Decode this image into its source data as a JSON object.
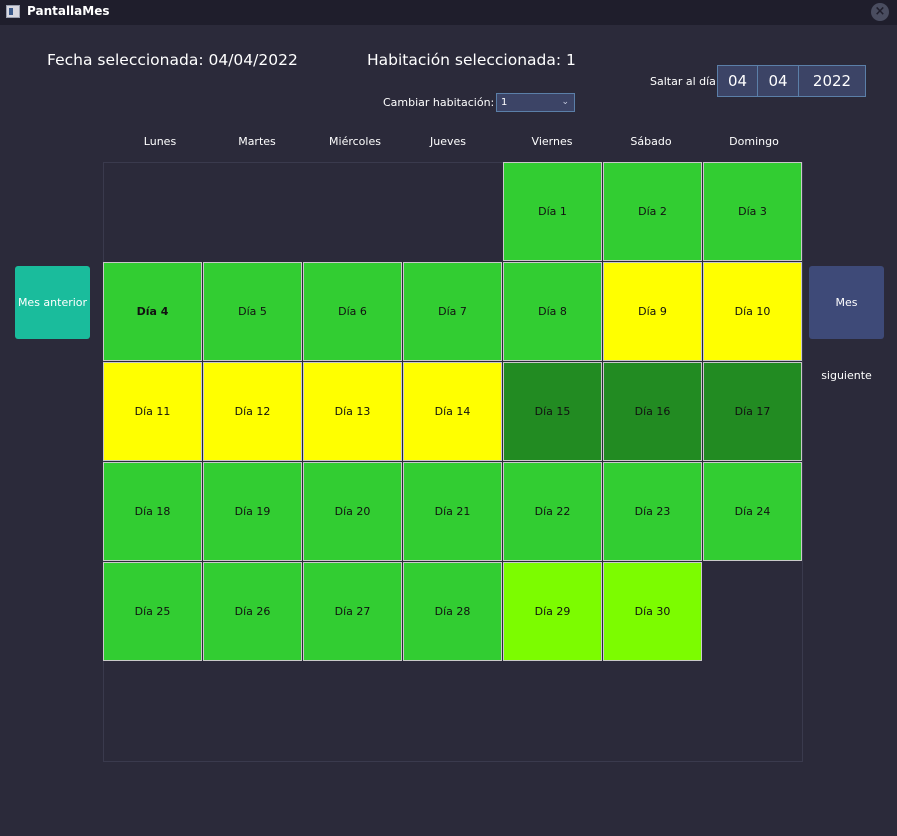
{
  "window": {
    "title": "PantallaMes"
  },
  "header": {
    "selected_date": "Fecha seleccionada: 04/04/2022",
    "selected_room": "Habitación seleccionada: 1",
    "jump_label": "Saltar al día:",
    "jump_day": "04",
    "jump_month": "04",
    "jump_year": "2022",
    "change_room_label": "Cambiar habitación:",
    "room_value": "1"
  },
  "weekdays": [
    "Lunes",
    "Martes",
    "Miércoles",
    "Jueves",
    "Viernes",
    "Sábado",
    "Domingo"
  ],
  "nav": {
    "prev": "Mes anterior",
    "next": "Mes siguiente"
  },
  "colors": {
    "green": "#32cd32",
    "yellow": "#ffff00",
    "dark_green": "#228b22",
    "light_green": "#7cfc00",
    "prev_button": "#1abc9c",
    "next_button": "#3e4a78"
  },
  "calendar": {
    "first_weekday_index": 4,
    "days": [
      {
        "label": "Día 1",
        "status": "green"
      },
      {
        "label": "Día 2",
        "status": "green"
      },
      {
        "label": "Día 3",
        "status": "green"
      },
      {
        "label": "Día 4",
        "status": "green",
        "selected": true
      },
      {
        "label": "Día 5",
        "status": "green"
      },
      {
        "label": "Día 6",
        "status": "green"
      },
      {
        "label": "Día 7",
        "status": "green"
      },
      {
        "label": "Día 8",
        "status": "green"
      },
      {
        "label": "Día 9",
        "status": "yellow"
      },
      {
        "label": "Día 10",
        "status": "yellow"
      },
      {
        "label": "Día 11",
        "status": "yellow"
      },
      {
        "label": "Día 12",
        "status": "yellow"
      },
      {
        "label": "Día 13",
        "status": "yellow"
      },
      {
        "label": "Día 14",
        "status": "yellow"
      },
      {
        "label": "Día 15",
        "status": "dark_green"
      },
      {
        "label": "Día 16",
        "status": "dark_green"
      },
      {
        "label": "Día 17",
        "status": "dark_green"
      },
      {
        "label": "Día 18",
        "status": "green"
      },
      {
        "label": "Día 19",
        "status": "green"
      },
      {
        "label": "Día 20",
        "status": "green"
      },
      {
        "label": "Día 21",
        "status": "green"
      },
      {
        "label": "Día 22",
        "status": "green"
      },
      {
        "label": "Día 23",
        "status": "green"
      },
      {
        "label": "Día 24",
        "status": "green"
      },
      {
        "label": "Día 25",
        "status": "green"
      },
      {
        "label": "Día 26",
        "status": "green"
      },
      {
        "label": "Día 27",
        "status": "green"
      },
      {
        "label": "Día 28",
        "status": "green"
      },
      {
        "label": "Día 29",
        "status": "light_green"
      },
      {
        "label": "Día 30",
        "status": "light_green"
      }
    ]
  }
}
